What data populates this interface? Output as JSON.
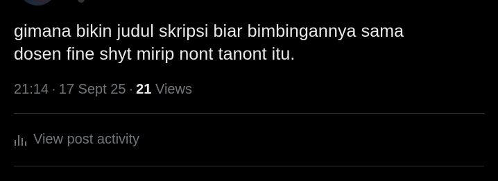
{
  "tweet": {
    "text_line1": "gimana bikin judul skripsi biar bimbingannya sama",
    "text_line2": "dosen fine shyt mirip nont tanont itu.",
    "time": "21:14",
    "date": "17 Sept 25",
    "views_count": "21",
    "views_label": "Views",
    "separator": "·"
  },
  "activity": {
    "label": "View post activity",
    "icon": "analytics-bars-icon"
  },
  "colors": {
    "background": "#000000",
    "primary_text": "#e7e9ea",
    "secondary_text": "#71767b",
    "divider": "#2f3336"
  }
}
